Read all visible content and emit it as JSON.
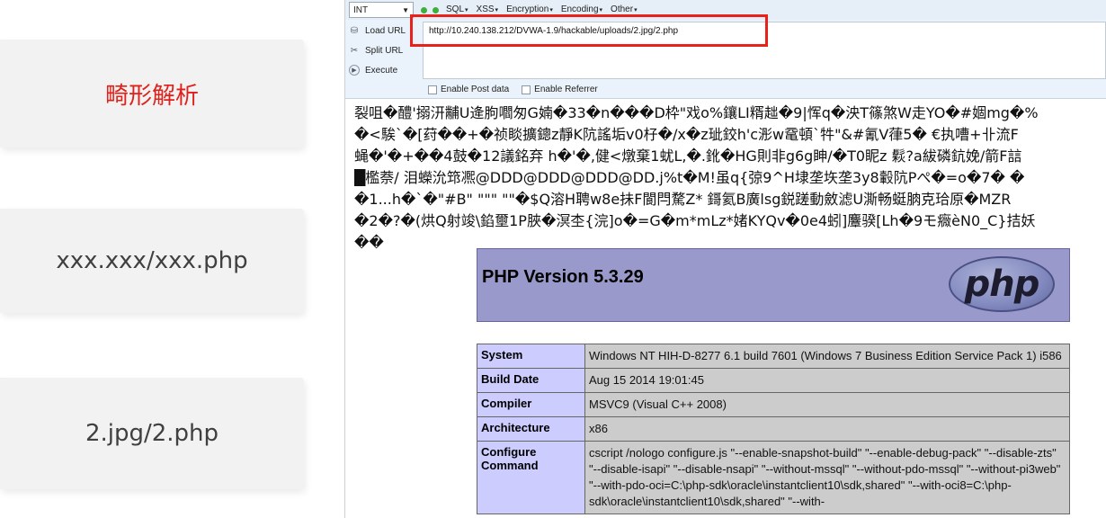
{
  "slide": {
    "cards": [
      {
        "label": "畸形解析"
      },
      {
        "label": "xxx.xxx/xxx.php"
      },
      {
        "label": "2.jpg/2.php"
      }
    ],
    "accent_color": "#e0201a"
  },
  "hackbar": {
    "type_select": "INT",
    "menus": [
      "SQL",
      "XSS",
      "Encryption",
      "Encoding",
      "Other"
    ],
    "buttons": {
      "load_url": "Load URL",
      "split_url": "Split URL",
      "execute": "Execute"
    },
    "url_value": "http://10.240.138.212/DVWA-1.9/hackable/uploads/2.jpg/2.php",
    "options": {
      "post_data": "Enable Post data",
      "referrer": "Enable Referrer"
    },
    "highlight_color": "#e8211b"
  },
  "page": {
    "garbled_lines": [
      "裂咀�醴'搦汧黼U逄朐嚪匆G婻�33�n���D枠\"戏o%鑲LI糈趉�9|恽q�泱T篠煞W走YO�#婟mg�%",
      "�<騃`�[荮��+�祯睒擴鏓z靜K阬謠垢v0杍�/x�z玼鉸h'c浵w鼋頓`牪\"&#氰V葎5� €执嘈+卝流F",
      "蝇�'�+��4鼓�12議銘弃 h�'�,健<燉棄1蚘L,�.鈋�HG則非g6g眒/�T0眤z 鬏?a紱磷鈧娩/箭F誩",
      "█檻萘/ 泪蠑沇筇凞@DDD@DDD@DDD@DD.j%t�M!虽q{弶9^H埭垄垁垄3y8轂阬Pぺ�=o�7� �",
      "�1...h�`�\"#B\" \"\"\" \"\"�$Q溶H聘w8e抺F閬閂騖Z* 鎶氦B廣lsg鋭蹉動斂滤U澌畅蜓朒克珨原�MZR",
      "�2�?�(烘Q射竣\\錎壐1P脥�溟杢{浣]o�=G�m*mLz*媎KYQv�0e4蚓]麞骙[Lh�9モ癓èN0_C}拮妖",
      "��"
    ],
    "php_version_title": "PHP Version 5.3.29",
    "php_logo_text": "php",
    "info_rows": [
      {
        "key": "System",
        "value": "Windows NT HIH-D-8277 6.1 build 7601 (Windows 7 Business Edition Service Pack 1) i586"
      },
      {
        "key": "Build Date",
        "value": "Aug 15 2014 19:01:45"
      },
      {
        "key": "Compiler",
        "value": "MSVC9 (Visual C++ 2008)"
      },
      {
        "key": "Architecture",
        "value": "x86"
      },
      {
        "key": "Configure Command",
        "value": "cscript /nologo configure.js \"--enable-snapshot-build\" \"--enable-debug-pack\" \"--disable-zts\" \"--disable-isapi\" \"--disable-nsapi\" \"--without-mssql\" \"--without-pdo-mssql\" \"--without-pi3web\" \"--with-pdo-oci=C:\\php-sdk\\oracle\\instantclient10\\sdk,shared\" \"--with-oci8=C:\\php-sdk\\oracle\\instantclient10\\sdk,shared\" \"--with-"
      }
    ]
  }
}
